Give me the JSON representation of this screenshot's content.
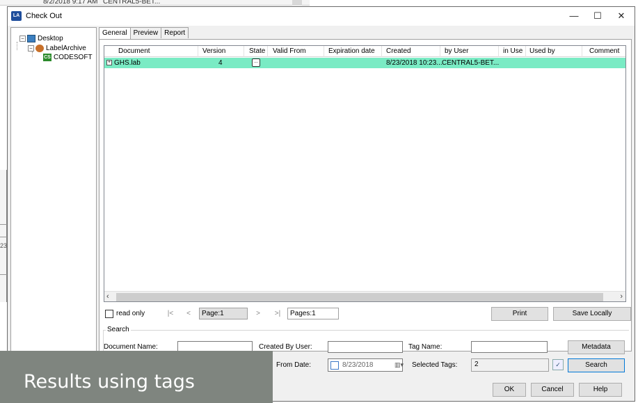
{
  "background": {
    "date": "8/2/2018 9:17 AM",
    "user": "CENTRAL5-BET...",
    "side_text": "23"
  },
  "window": {
    "title": "Check Out",
    "app_icon_text": "LA",
    "minimize": "—",
    "maximize": "☐",
    "close": "✕"
  },
  "tree": {
    "desktop": "Desktop",
    "archive": "LabelArchive",
    "codesoft": "CODESOFT",
    "codesoft_icon_text": "CS"
  },
  "tabs": [
    "General",
    "Preview",
    "Report"
  ],
  "grid": {
    "columns": [
      "Document",
      "Version",
      "State",
      "Valid From",
      "Expiration date",
      "Created",
      "by User",
      "in Use",
      "Used by",
      "Comment"
    ],
    "rows": [
      {
        "document": "GHS.lab",
        "version": "4",
        "state_icon": "...",
        "valid_from": "",
        "expiration": "",
        "created": "8/23/2018 10:23...",
        "by_user": "CENTRAL5-BET...",
        "in_use": "",
        "used_by": "",
        "comment": ""
      }
    ],
    "row_highlight_color": "#7aebc4"
  },
  "pager": {
    "read_only_label": "read only",
    "first": "|<",
    "prev": "<",
    "page": "Page:1",
    "next": ">",
    "last": ">|",
    "pages": "Pages:1",
    "print_label": "Print",
    "save_label": "Save Locally"
  },
  "search": {
    "title": "Search",
    "document_name_label": "Document Name:",
    "created_by_label": "Created By User:",
    "tag_name_label": "Tag Name:",
    "metadata_label": "Metadata",
    "from_date_label": "From Date:",
    "from_date_value": "8/23/2018",
    "selected_tags_label": "Selected Tags:",
    "selected_tags_value": "2",
    "search_label": "Search"
  },
  "footer": {
    "ok_label": "OK",
    "cancel_label": "Cancel",
    "help_label": "Help"
  },
  "overlay": {
    "text": "Results using tags"
  }
}
